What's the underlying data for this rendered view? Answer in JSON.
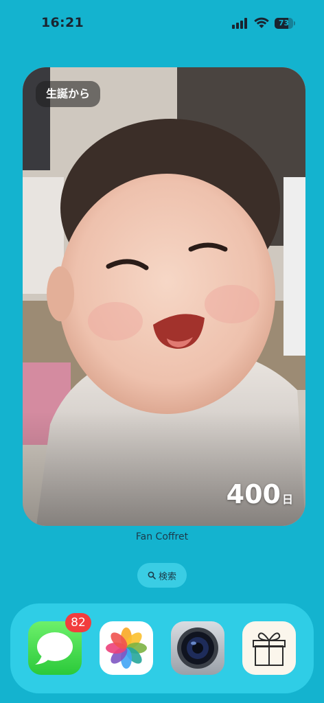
{
  "status_bar": {
    "time": "16:21",
    "battery_percent": "73",
    "battery_level": 0.73
  },
  "widget": {
    "label": "生誕から",
    "days_number": "400",
    "days_unit": "日",
    "name": "Fan Coffret"
  },
  "search": {
    "label": "検索",
    "icon": "magnifying-glass-icon"
  },
  "dock": {
    "apps": [
      {
        "app": "messages",
        "icon": "speech-bubble-icon",
        "badge": "82"
      },
      {
        "app": "photos",
        "icon": "flower-icon"
      },
      {
        "app": "camera",
        "icon": "camera-lens-icon"
      },
      {
        "app": "gift",
        "icon": "gift-box-icon"
      }
    ]
  },
  "colors": {
    "wallpaper": "#14b3cf",
    "badge": "#f23d3d",
    "messages": "#2bc93a"
  }
}
